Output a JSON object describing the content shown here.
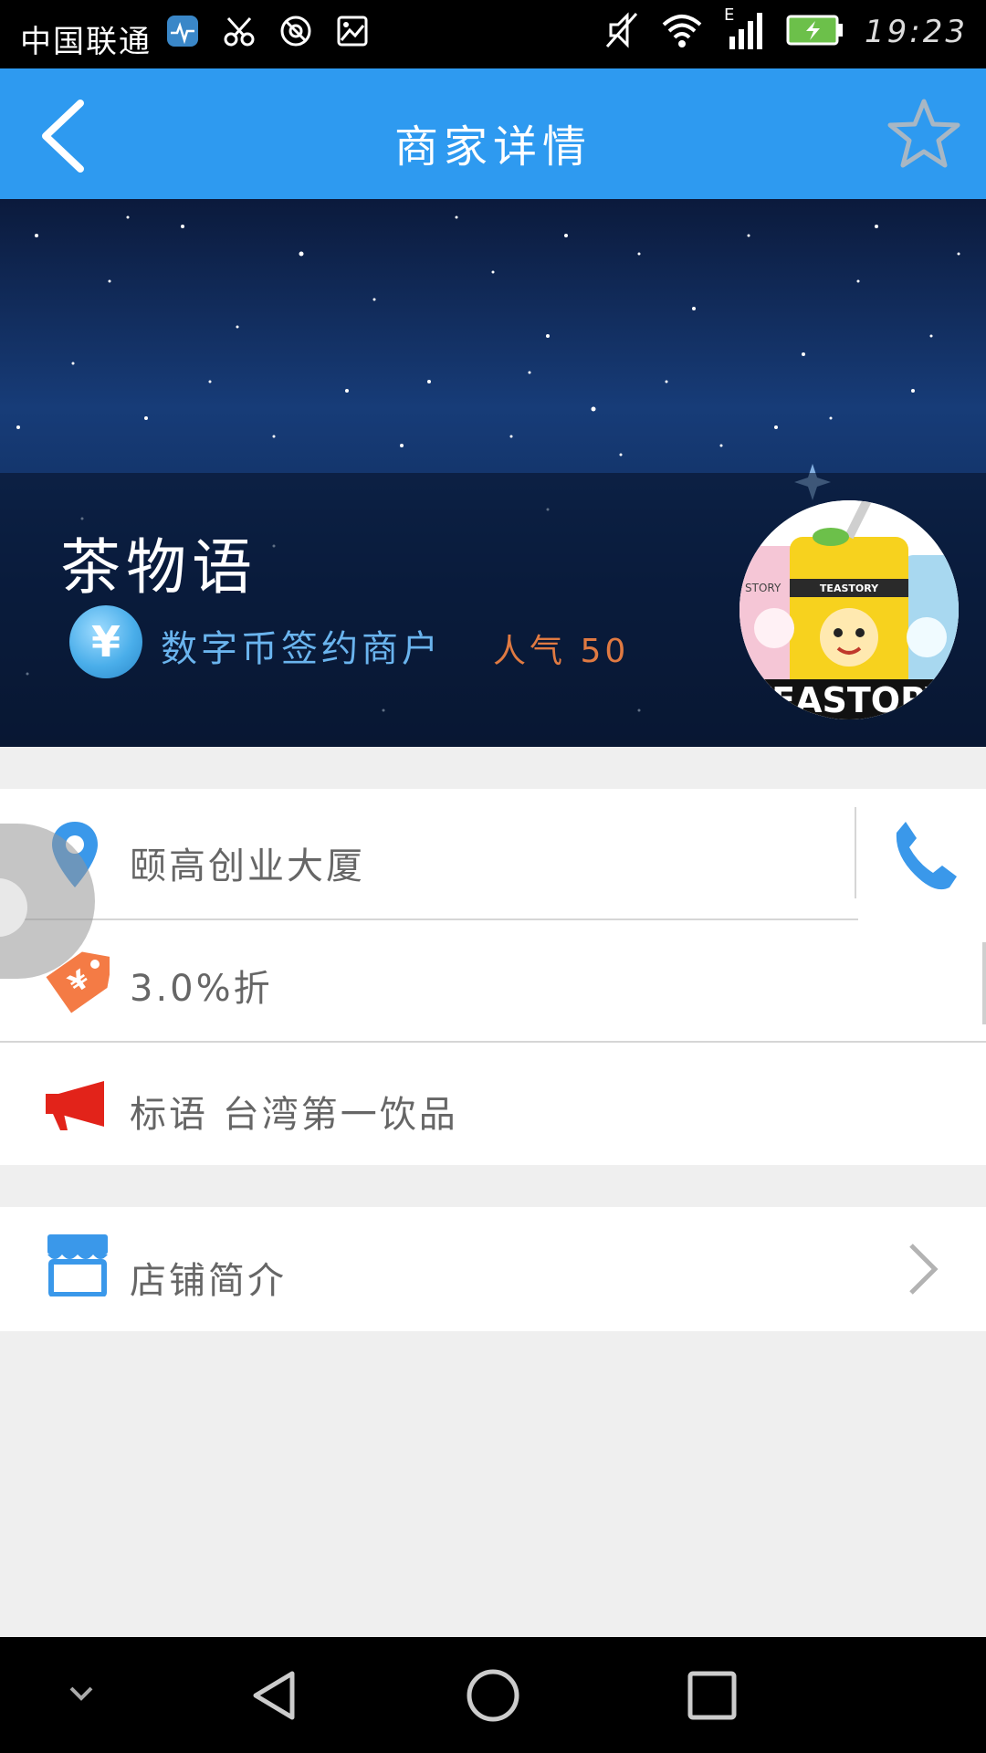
{
  "status_bar": {
    "carrier": "中国联通",
    "time": "19:23",
    "network_type": "E",
    "icons": [
      "heart-rate-app-icon",
      "scissors-icon",
      "settings-app-icon",
      "image-icon",
      "mute-icon",
      "wifi-icon",
      "signal-icon",
      "battery-charging-icon"
    ]
  },
  "app_bar": {
    "title": "商家详情",
    "back_icon": "chevron-left-icon",
    "favorite_icon": "star-outline-icon"
  },
  "shop": {
    "name": "茶物语",
    "coin_symbol": "¥",
    "merchant_type": "数字币签约商户",
    "popularity": "人气 50",
    "logo_text": "TEASTORY",
    "logo_text_small": "TEASTORY",
    "logo_text_left": "STORY"
  },
  "info": {
    "address": "颐高创业大厦",
    "discount": "3.0%折",
    "slogan": "标语  台湾第一饮品"
  },
  "intro": {
    "label": "店铺简介"
  },
  "colors": {
    "accent": "#2e9af0",
    "popularity": "#e07a42",
    "merchant_type": "#6ab4ee",
    "discount_tag": "#f47b45",
    "slogan_icon": "#e2231a"
  }
}
